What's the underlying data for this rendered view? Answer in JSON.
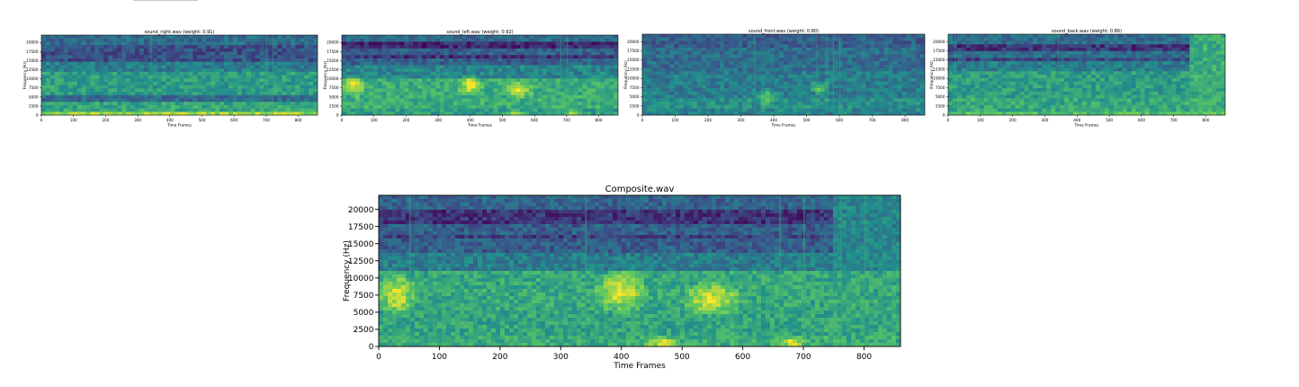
{
  "colormap": [
    "#440154",
    "#3b528b",
    "#21918c",
    "#5ec962",
    "#fde725"
  ],
  "chart_data": [
    {
      "type": "heatmap",
      "title": "sound_right.wav (weight: 0.91)",
      "xlabel": "Time Frames",
      "ylabel": "Frequency (Hz)",
      "xlim": [
        0,
        860
      ],
      "ylim": [
        0,
        22050
      ],
      "xticks": [
        0,
        100,
        200,
        300,
        400,
        500,
        600,
        700,
        800
      ],
      "yticks": [
        0,
        2500,
        5000,
        7500,
        10000,
        12500,
        15000,
        17500,
        20000
      ],
      "bands": [
        {
          "from": 0,
          "to": 1000,
          "level": 0.85
        },
        {
          "from": 1000,
          "to": 4000,
          "level": 0.6
        },
        {
          "from": 4000,
          "to": 5500,
          "level": 0.35
        },
        {
          "from": 5500,
          "to": 12000,
          "level": 0.55
        },
        {
          "from": 12000,
          "to": 15000,
          "level": 0.42
        },
        {
          "from": 15000,
          "to": 19000,
          "level": 0.25
        },
        {
          "from": 19000,
          "to": 22050,
          "level": 0.35
        }
      ],
      "vlines": [
        340,
        700,
        720
      ]
    },
    {
      "type": "heatmap",
      "title": "sound_left.wav (weight: 0.92)",
      "xlabel": "Time Frames",
      "ylabel": "Frequency (Hz)",
      "xlim": [
        0,
        860
      ],
      "ylim": [
        0,
        22050
      ],
      "xticks": [
        0,
        100,
        200,
        300,
        400,
        500,
        600,
        700,
        800
      ],
      "yticks": [
        0,
        2500,
        5000,
        7500,
        10000,
        12500,
        15000,
        17500,
        20000
      ],
      "bands": [
        {
          "from": 0,
          "to": 1500,
          "level": 0.55
        },
        {
          "from": 1500,
          "to": 6500,
          "level": 0.62
        },
        {
          "from": 6500,
          "to": 10500,
          "level": 0.62
        },
        {
          "from": 10500,
          "to": 13500,
          "level": 0.45
        },
        {
          "from": 13500,
          "to": 15500,
          "level": 0.3
        },
        {
          "from": 15500,
          "to": 16500,
          "level": 0.15
        },
        {
          "from": 16500,
          "to": 18000,
          "level": 0.3
        },
        {
          "from": 18000,
          "to": 19800,
          "level": 0.12
        },
        {
          "from": 19800,
          "to": 22050,
          "level": 0.35
        }
      ],
      "blobs": [
        {
          "t": 40,
          "f": 8000,
          "rt": 30,
          "rf": 2500
        },
        {
          "t": 400,
          "f": 8500,
          "rt": 30,
          "rf": 2500
        },
        {
          "t": 550,
          "f": 7000,
          "rt": 35,
          "rf": 2000
        },
        {
          "t": 540,
          "f": 500,
          "rt": 20,
          "rf": 800
        },
        {
          "t": 720,
          "f": 600,
          "rt": 25,
          "rf": 700
        }
      ],
      "vlines": [
        680,
        700
      ]
    },
    {
      "type": "heatmap",
      "title": "sound_front.wav (weight: 0.80)",
      "xlabel": "Time Frames",
      "ylabel": "Frequency (Hz)",
      "xlim": [
        0,
        860
      ],
      "ylim": [
        0,
        22050
      ],
      "xticks": [
        0,
        100,
        200,
        300,
        400,
        500,
        600,
        700,
        800
      ],
      "yticks": [
        0,
        2500,
        5000,
        7500,
        10000,
        12500,
        15000,
        17500,
        20000
      ],
      "bands": [
        {
          "from": 0,
          "to": 2000,
          "level": 0.45
        },
        {
          "from": 2000,
          "to": 5000,
          "level": 0.5
        },
        {
          "from": 5000,
          "to": 12000,
          "level": 0.42
        },
        {
          "from": 12000,
          "to": 18000,
          "level": 0.35
        },
        {
          "from": 18000,
          "to": 22050,
          "level": 0.3
        }
      ],
      "blobs": [
        {
          "t": 540,
          "f": 7500,
          "rt": 25,
          "rf": 1500
        },
        {
          "t": 380,
          "f": 5000,
          "rt": 30,
          "rf": 1500
        }
      ],
      "vlines": [
        340,
        530,
        560,
        580,
        600
      ]
    },
    {
      "type": "heatmap",
      "title": "sound_back.wav (weight: 0.86)",
      "xlabel": "Time Frames",
      "ylabel": "Frequency (Hz)",
      "xlim": [
        0,
        860
      ],
      "ylim": [
        0,
        22050
      ],
      "xticks": [
        0,
        100,
        200,
        300,
        400,
        500,
        600,
        700,
        800
      ],
      "yticks": [
        0,
        2500,
        5000,
        7500,
        10000,
        12500,
        15000,
        17500,
        20000
      ],
      "bands": [
        {
          "from": 0,
          "to": 1000,
          "level": 0.7
        },
        {
          "from": 1000,
          "to": 5000,
          "level": 0.6
        },
        {
          "from": 5000,
          "to": 12000,
          "level": 0.55
        },
        {
          "from": 12000,
          "to": 14500,
          "level": 0.42
        },
        {
          "from": 14500,
          "to": 16000,
          "level": 0.22
        },
        {
          "from": 16000,
          "to": 17000,
          "level": 0.35
        },
        {
          "from": 17000,
          "to": 19000,
          "level": 0.15
        },
        {
          "from": 19000,
          "to": 22050,
          "level": 0.35
        }
      ],
      "bright_region": {
        "from_t": 750,
        "to_t": 860,
        "level": 0.62
      },
      "vlines": [
        20,
        340,
        750
      ]
    },
    {
      "type": "heatmap",
      "title": "Composite.wav",
      "xlabel": "Time Frames",
      "ylabel": "Frequency (Hz)",
      "xlim": [
        0,
        860
      ],
      "ylim": [
        0,
        22050
      ],
      "xticks": [
        0,
        100,
        200,
        300,
        400,
        500,
        600,
        700,
        800
      ],
      "yticks": [
        0,
        2500,
        5000,
        7500,
        10000,
        12500,
        15000,
        17500,
        20000
      ],
      "bands": [
        {
          "from": 0,
          "to": 1500,
          "level": 0.62
        },
        {
          "from": 1500,
          "to": 5000,
          "level": 0.58
        },
        {
          "from": 5000,
          "to": 11000,
          "level": 0.6
        },
        {
          "from": 11000,
          "to": 13500,
          "level": 0.42
        },
        {
          "from": 13500,
          "to": 15500,
          "level": 0.3
        },
        {
          "from": 15500,
          "to": 16500,
          "level": 0.2
        },
        {
          "from": 16500,
          "to": 18000,
          "level": 0.3
        },
        {
          "from": 18000,
          "to": 19800,
          "level": 0.15
        },
        {
          "from": 19800,
          "to": 22050,
          "level": 0.32
        }
      ],
      "blobs": [
        {
          "t": 30,
          "f": 7500,
          "rt": 25,
          "rf": 2500
        },
        {
          "t": 400,
          "f": 8000,
          "rt": 35,
          "rf": 2500
        },
        {
          "t": 550,
          "f": 7000,
          "rt": 40,
          "rf": 2000
        },
        {
          "t": 470,
          "f": 500,
          "rt": 25,
          "rf": 700
        },
        {
          "t": 680,
          "f": 600,
          "rt": 20,
          "rf": 700
        }
      ],
      "bright_region": {
        "from_t": 750,
        "to_t": 860,
        "level": 0.45
      },
      "vlines": [
        50,
        340,
        660,
        700,
        760,
        800
      ]
    }
  ]
}
